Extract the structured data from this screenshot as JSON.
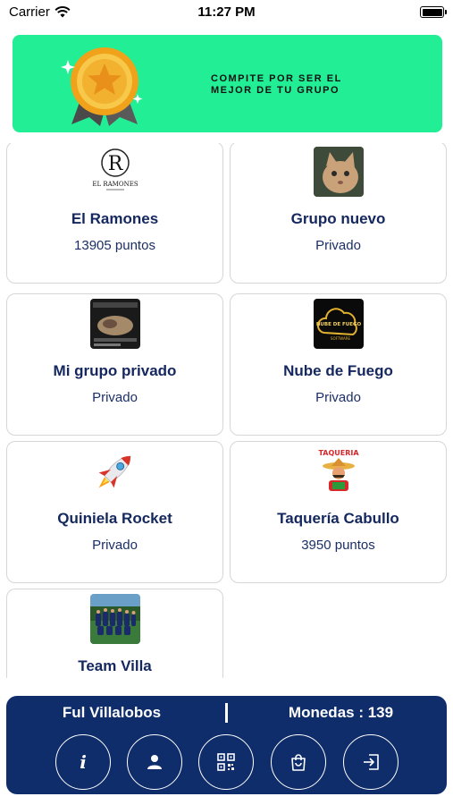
{
  "status_bar": {
    "carrier": "Carrier",
    "time": "11:27 PM"
  },
  "banner": {
    "line1": "COMPITE POR SER EL",
    "line2": "MEJOR DE TU GRUPO"
  },
  "groups": [
    {
      "name": "El Ramones",
      "sub": "13905 puntos",
      "logo_text": "EL RAMONES",
      "icon": "ramones-logo-icon"
    },
    {
      "name": "Grupo nuevo",
      "sub": "Privado",
      "icon": "cat-photo-icon"
    },
    {
      "name": "Mi grupo privado",
      "sub": "Privado",
      "icon": "screenshot-thumb-icon"
    },
    {
      "name": "Nube de Fuego",
      "sub": "Privado",
      "logo_text": "NUBE DE FUEGO",
      "logo_sub": "SOFTWARE",
      "icon": "cloud-logo-icon"
    },
    {
      "name": "Quiniela Rocket",
      "sub": "Privado",
      "icon": "rocket-icon"
    },
    {
      "name": "Taquería Cabullo",
      "sub": "3950 puntos",
      "logo_text": "TAQUERIA",
      "icon": "taqueria-logo-icon"
    },
    {
      "name": "Team Villa",
      "sub": "",
      "icon": "team-photo-icon"
    }
  ],
  "footer": {
    "user_name": "Ful Villalobos",
    "coins_label": "Monedas : 139"
  },
  "nav": [
    {
      "label": "i",
      "icon": "info-icon"
    },
    {
      "icon": "user-icon"
    },
    {
      "icon": "qr-code-icon"
    },
    {
      "icon": "shopping-bag-icon"
    },
    {
      "icon": "logout-icon"
    }
  ],
  "colors": {
    "banner": "#22ee95",
    "navy": "#0f2c6b",
    "title": "#14275e"
  }
}
